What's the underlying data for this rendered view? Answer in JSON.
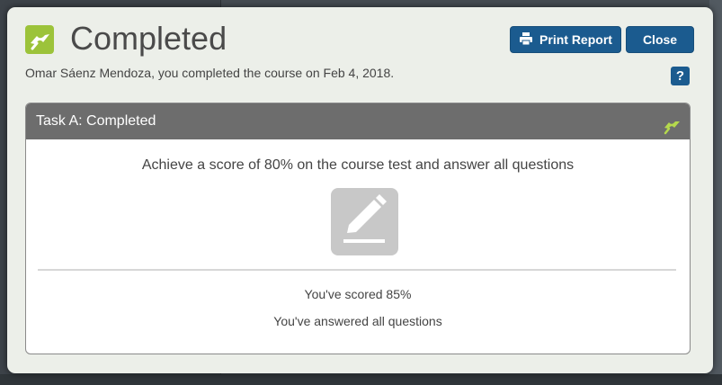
{
  "dialog": {
    "title": "Completed",
    "subtitle": "Omar Sáenz Mendoza, you completed the course on Feb 4, 2018.",
    "help_label": "?",
    "print_label": "Print Report",
    "close_label": "Close"
  },
  "task": {
    "header": "Task A: Completed",
    "description": "Achieve a score of 80% on the course test and answer all questions",
    "results": [
      "You've scored 85%",
      "You've answered all questions"
    ]
  },
  "icons": {
    "header": "flag-icon",
    "print": "printer-icon",
    "task_status": "flag-icon",
    "task_type": "pencil-icon"
  },
  "colors": {
    "accent_green": "#9cc33a",
    "button_blue": "#1b5b8f",
    "task_header": "#6d6d6d",
    "dialog_bg": "#ecefe9"
  }
}
